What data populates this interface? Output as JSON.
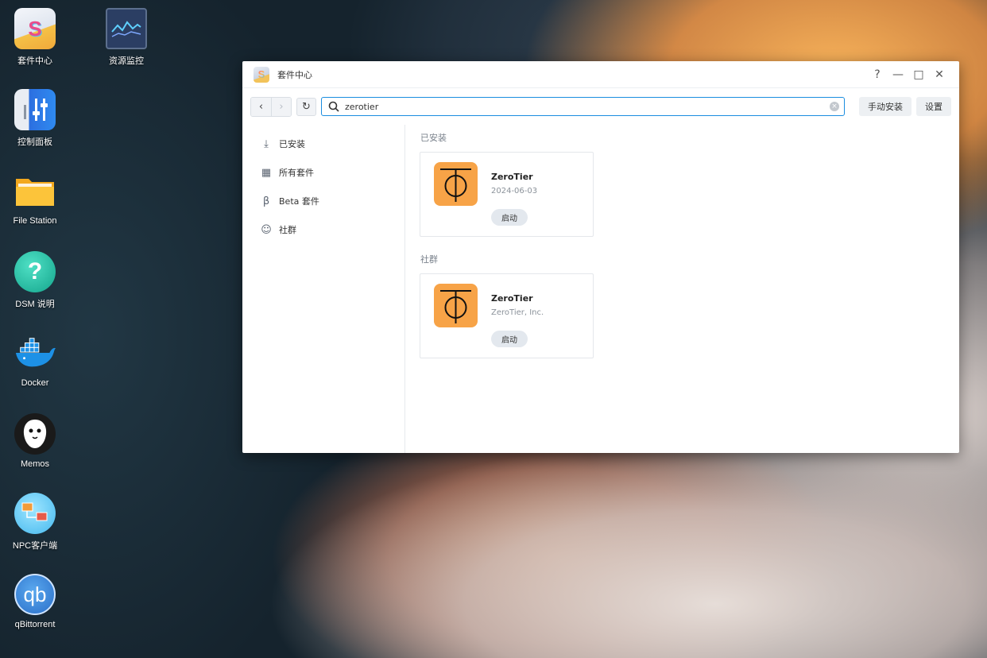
{
  "desktop": {
    "icons": [
      {
        "label": "套件中心",
        "icon": "package-center-icon"
      },
      {
        "label": "资源监控",
        "icon": "resource-monitor-icon"
      },
      {
        "label": "控制面板",
        "icon": "control-panel-icon"
      },
      {
        "label": "File Station",
        "icon": "folder-icon"
      },
      {
        "label": "DSM 说明",
        "icon": "help-icon"
      },
      {
        "label": "Docker",
        "icon": "docker-icon"
      },
      {
        "label": "Memos",
        "icon": "memos-icon"
      },
      {
        "label": "NPC客户端",
        "icon": "npc-client-icon"
      },
      {
        "label": "qBittorrent",
        "icon": "qbittorrent-icon"
      }
    ]
  },
  "window": {
    "title": "套件中心",
    "controls": {
      "help": "?",
      "minimize": "—",
      "maximize": "□",
      "close": "✕"
    }
  },
  "toolbar": {
    "search_value": "zerotier",
    "manual_install_label": "手动安装",
    "settings_label": "设置"
  },
  "sidebar": {
    "items": [
      {
        "label": "已安装",
        "icon": "download-icon"
      },
      {
        "label": "所有套件",
        "icon": "grid-icon"
      },
      {
        "label": "Beta 套件",
        "icon": "beta-icon"
      },
      {
        "label": "社群",
        "icon": "community-icon"
      }
    ]
  },
  "sections": [
    {
      "title": "已安装",
      "package": {
        "name": "ZeroTier",
        "subtitle": "2024-06-03",
        "button": "启动"
      }
    },
    {
      "title": "社群",
      "package": {
        "name": "ZeroTier",
        "subtitle": "ZeroTier, Inc.",
        "button": "启动"
      }
    }
  ],
  "colors": {
    "accent": "#1a8de0",
    "zerotier_orange": "#f7a347"
  }
}
